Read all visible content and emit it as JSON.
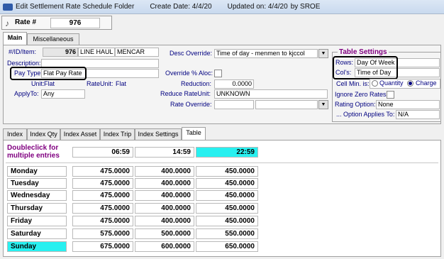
{
  "window": {
    "title": "Edit Settlement Rate Schedule Folder",
    "create_date": "Create Date: 4/4/20",
    "updated_on": "Updated on: 4/4/20",
    "by": "by  SROE"
  },
  "rate": {
    "label": "Rate #",
    "value": "976"
  },
  "top_tabs": {
    "main": "Main",
    "misc": "Miscellaneous"
  },
  "main": {
    "id_item_label": "#/ID/Item:",
    "id_value": "976",
    "item1": "LINE HAUL",
    "item2": "MENCAR",
    "description_label": "Description:",
    "pay_type_label": "Pay Type",
    "pay_type_value": "Flat Pay Rate",
    "unit_label": "Unit:",
    "unit_value": "Flat",
    "rate_unit_label": "RateUnit:",
    "rate_unit_value": "Flat",
    "apply_to_label": "ApplyTo:",
    "apply_to_value": "Any",
    "desc_override_label": "Desc Override:",
    "desc_override_value": "Time of day - menmen to kjccol",
    "override_aloc_label": "Override % Aloc:",
    "reduction_label": "Reduction:",
    "reduction_value": "0.0000",
    "reduce_rate_unit_label": "Reduce RateUnit:",
    "reduce_rate_unit_value": "UNKNOWN",
    "rate_override_label": "Rate Override:"
  },
  "table_settings": {
    "title": "Table Settings",
    "rows_label": "Rows:",
    "rows_value": "Day Of Week",
    "cols_label": "Col's:",
    "cols_value": "Time of Day",
    "cell_min_label": "Cell Min. is:",
    "quantity_label": "Quantity",
    "charge_label": "Charge",
    "ignore_zero_label": "Ignore Zero Rates",
    "rating_option_label": "Rating Option:",
    "rating_option_value": "None",
    "option_applies_label": "... Option Applies To:",
    "option_applies_value": "N/A"
  },
  "bottom_tabs": [
    "Index",
    "Index Qty",
    "Index Asset",
    "Index Trip",
    "Index Settings",
    "Table"
  ],
  "grid": {
    "hint": "Doubleclick for multiple entries",
    "columns": [
      "06:59",
      "14:59",
      "22:59"
    ],
    "rows": [
      {
        "day": "Monday",
        "values": [
          "475.0000",
          "400.0000",
          "450.0000"
        ]
      },
      {
        "day": "Tuesday",
        "values": [
          "475.0000",
          "400.0000",
          "450.0000"
        ]
      },
      {
        "day": "Wednesday",
        "values": [
          "475.0000",
          "400.0000",
          "450.0000"
        ]
      },
      {
        "day": "Thursday",
        "values": [
          "475.0000",
          "400.0000",
          "450.0000"
        ]
      },
      {
        "day": "Friday",
        "values": [
          "475.0000",
          "400.0000",
          "450.0000"
        ]
      },
      {
        "day": "Saturday",
        "values": [
          "575.0000",
          "500.0000",
          "550.0000"
        ]
      },
      {
        "day": "Sunday",
        "values": [
          "675.0000",
          "600.0000",
          "650.0000"
        ]
      }
    ]
  },
  "colors": {
    "highlight_cyan": "#28f0f0",
    "label_blue": "#000080",
    "title_purple": "#800080"
  }
}
